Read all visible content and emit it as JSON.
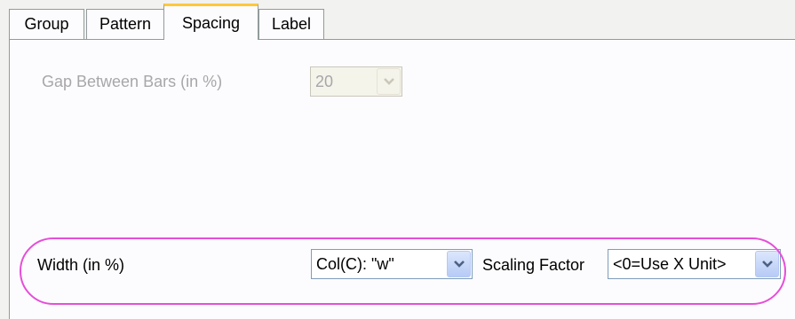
{
  "tabs": [
    {
      "label": "Group"
    },
    {
      "label": "Pattern"
    },
    {
      "label": "Spacing"
    },
    {
      "label": "Label"
    }
  ],
  "spacing": {
    "gap_label": "Gap Between Bars (in %)",
    "gap_value": "20",
    "width_label": "Width (in %)",
    "width_value": "Col(C): \"w\"",
    "scaling_label": "Scaling Factor",
    "scaling_value": "<0=Use X Unit>"
  },
  "colors": {
    "highlight": "#e64ed8",
    "active_tab_accent": "#ffc83c"
  },
  "icons": {
    "dropdown": "chevron-down-icon"
  }
}
